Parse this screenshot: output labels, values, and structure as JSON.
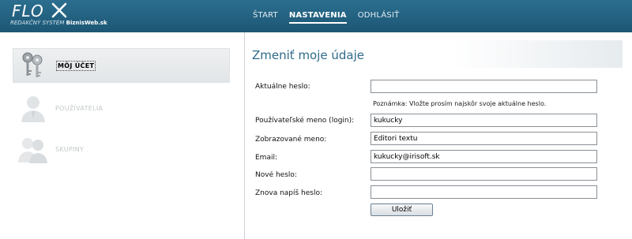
{
  "header": {
    "logo_word": "FLO",
    "logo_sub_prefix": "REDAKČNÝ SYSTÉM ",
    "logo_sub_brand": "BiznisWeb.sk",
    "nav": [
      {
        "label": "ŠTART",
        "active": false
      },
      {
        "label": "NASTAVENIA",
        "active": true
      },
      {
        "label": "ODHLÁSIŤ",
        "active": false
      }
    ]
  },
  "sidebar": {
    "items": [
      {
        "label": "MÔJ ÚČET",
        "icon": "keys-icon",
        "active": true
      },
      {
        "label": "POUŽÍVATELIA",
        "icon": "user-icon",
        "active": false
      },
      {
        "label": "SKUPINY",
        "icon": "group-icon",
        "active": false
      }
    ]
  },
  "main": {
    "title": "Zmeniť moje údaje",
    "fields": [
      {
        "label": "Aktuálne heslo:",
        "value": ""
      },
      {
        "label": "Používateľské meno (login):",
        "value": "kukucky"
      },
      {
        "label": "Zobrazované meno:",
        "value": "Editori textu"
      },
      {
        "label": "Email:",
        "value": "kukucky@irisoft.sk"
      },
      {
        "label": "Nové heslo:",
        "value": ""
      },
      {
        "label": "Znova napíš heslo:",
        "value": ""
      }
    ],
    "note": "Poznámka: Vložte prosím najskôr svoje aktuálne heslo.",
    "save_label": "Uložiť"
  },
  "colors": {
    "header_bg": "#1d5674",
    "title_color": "#2f6a8a",
    "active_item_bg": "#e2e5e7"
  }
}
